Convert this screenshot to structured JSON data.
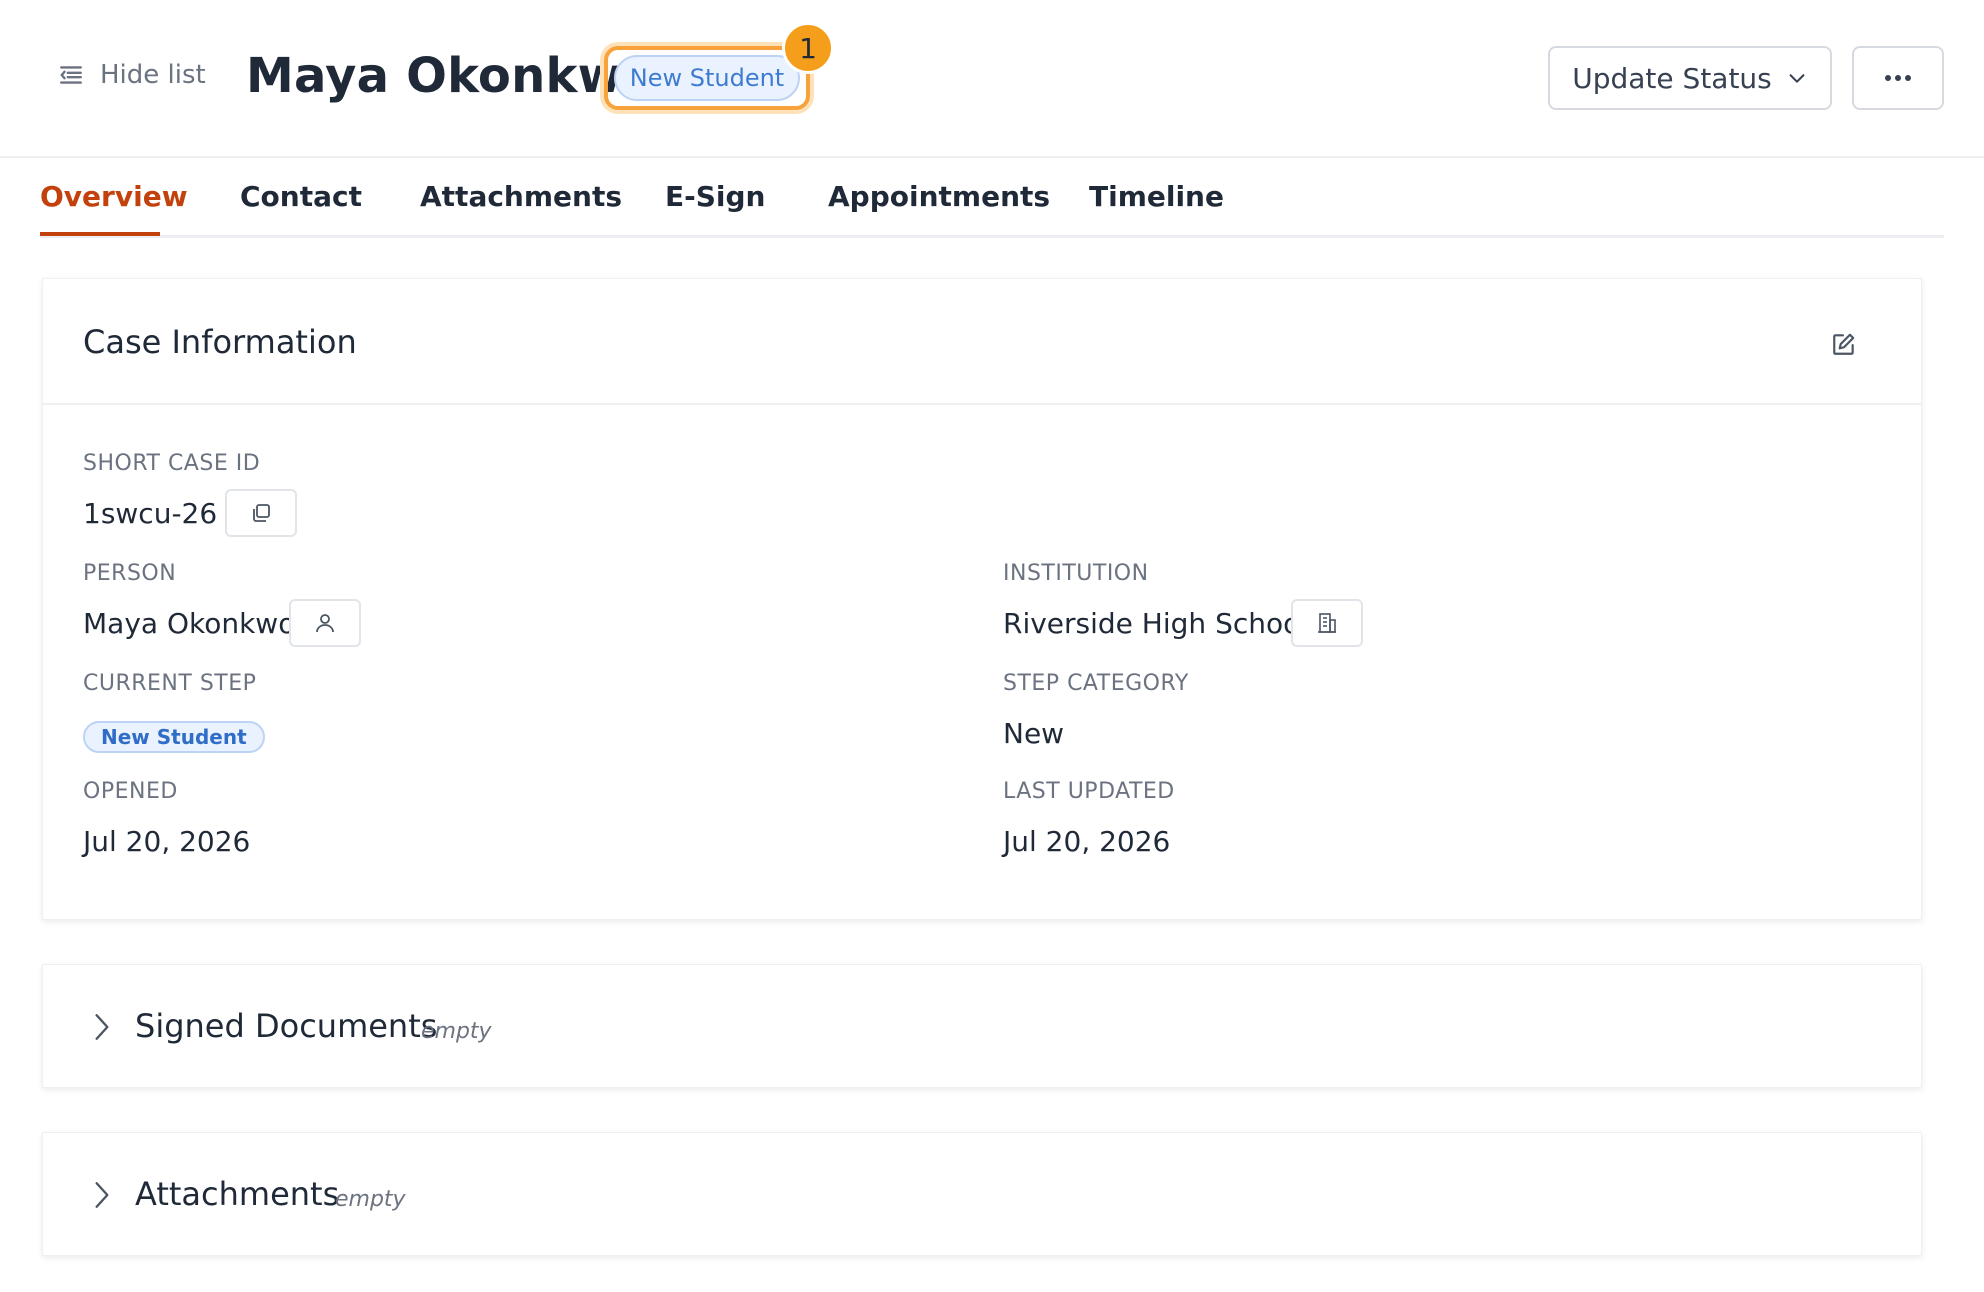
{
  "header": {
    "hide_list_label": "Hide list",
    "title": "Maya Okonkwo",
    "status_badge": "New Student",
    "notification_count": "1",
    "update_status_label": "Update Status"
  },
  "tabs": [
    {
      "label": "Overview",
      "active": true
    },
    {
      "label": "Contact",
      "active": false
    },
    {
      "label": "Attachments",
      "active": false
    },
    {
      "label": "E-Sign",
      "active": false
    },
    {
      "label": "Appointments",
      "active": false
    },
    {
      "label": "Timeline",
      "active": false
    }
  ],
  "case_info": {
    "title": "Case Information",
    "short_case_id_label": "SHORT CASE ID",
    "short_case_id": "1swcu-26",
    "person_label": "PERSON",
    "person": "Maya Okonkwo",
    "institution_label": "INSTITUTION",
    "institution": "Riverside High School",
    "current_step_label": "CURRENT STEP",
    "current_step": "New Student",
    "step_category_label": "STEP CATEGORY",
    "step_category": "New",
    "opened_label": "OPENED",
    "opened": "Jul 20, 2026",
    "last_updated_label": "LAST UPDATED",
    "last_updated": "Jul 20, 2026"
  },
  "signed_documents": {
    "title": "Signed Documents",
    "state": "empty"
  },
  "attachments": {
    "title": "Attachments",
    "state": "empty"
  },
  "colors": {
    "accent": "#c2410c",
    "badge_bg": "#eaf2ff",
    "badge_text": "#3e7bd1",
    "highlight": "#f7a23b"
  },
  "icons": [
    "list-icon",
    "chevron-down-icon",
    "more-dots-icon",
    "edit-icon",
    "copy-icon",
    "user-icon",
    "building-icon",
    "chevron-right-icon"
  ]
}
